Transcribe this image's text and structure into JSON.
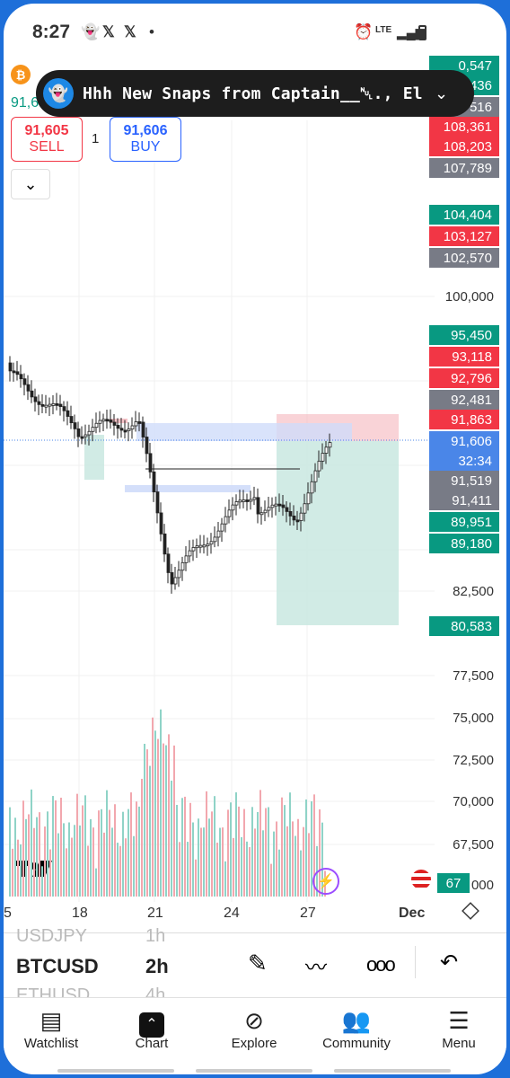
{
  "status_bar": {
    "time": "8:27",
    "icons": [
      "snapchat-icon",
      "x-icon",
      "x-icon",
      "dot-icon"
    ],
    "right_icons": [
      "alarm-icon",
      "lte-icon",
      "signal-icon",
      "battery-icon"
    ],
    "lte": "LTE"
  },
  "notification": {
    "text": "Hhh New Snaps from Captain__␀., El-Ja_",
    "icon": "snapchat-ghost-icon"
  },
  "header": {
    "symbol_partial": "91,6",
    "sell_price": "91,605",
    "sell_label": "SELL",
    "qty": "1",
    "buy_price": "91,606",
    "buy_label": "BUY"
  },
  "colors": {
    "green": "#089981",
    "red": "#f23645",
    "gray": "#787b86",
    "blue": "#2962ff",
    "current_blue": "#3d7fe0"
  },
  "price_labels": [
    {
      "text": "0,547",
      "color": "#089981"
    },
    {
      "text": "436",
      "color": "#089981"
    },
    {
      "text": "516",
      "color": "#787b86"
    },
    {
      "text": "108,361",
      "color": "#f23645"
    },
    {
      "text": "108,203",
      "color": "#f23645"
    },
    {
      "text": "107,789",
      "color": "#787b86"
    },
    {
      "text": "104,404",
      "color": "#089981"
    },
    {
      "text": "103,127",
      "color": "#f23645"
    },
    {
      "text": "102,570",
      "color": "#787b86"
    },
    {
      "text": "95,450",
      "color": "#089981"
    },
    {
      "text": "93,118",
      "color": "#f23645"
    },
    {
      "text": "92,796",
      "color": "#f23645"
    },
    {
      "text": "92,481",
      "color": "#787b86"
    },
    {
      "text": "91,863",
      "color": "#f23645"
    },
    {
      "text": "91,606",
      "color": "#4a86e8"
    },
    {
      "text": "32:34",
      "color": "#4a86e8"
    },
    {
      "text": "91,519",
      "color": "#787b86"
    },
    {
      "text": "91,411",
      "color": "#787b86"
    },
    {
      "text": "89,951",
      "color": "#089981"
    },
    {
      "text": "89,180",
      "color": "#089981"
    },
    {
      "text": "80,583",
      "color": "#089981"
    }
  ],
  "axis_labels": [
    "100,000",
    "82,500",
    "77,500",
    "75,000",
    "72,500",
    "70,000",
    "67,500",
    "000"
  ],
  "volume_label": "67",
  "time_axis": [
    "5",
    "18",
    "21",
    "24",
    "27",
    "Dec"
  ],
  "toolbar": {
    "symbols": [
      "USDJPY",
      "BTCUSD",
      "ETHUSD"
    ],
    "intervals": [
      "1h",
      "2h",
      "4h"
    ]
  },
  "nav": [
    {
      "label": "Watchlist",
      "icon": "watchlist-icon"
    },
    {
      "label": "Chart",
      "icon": "chart-icon"
    },
    {
      "label": "Explore",
      "icon": "compass-icon"
    },
    {
      "label": "Community",
      "icon": "community-icon"
    },
    {
      "label": "Menu",
      "icon": "menu-icon"
    }
  ]
}
